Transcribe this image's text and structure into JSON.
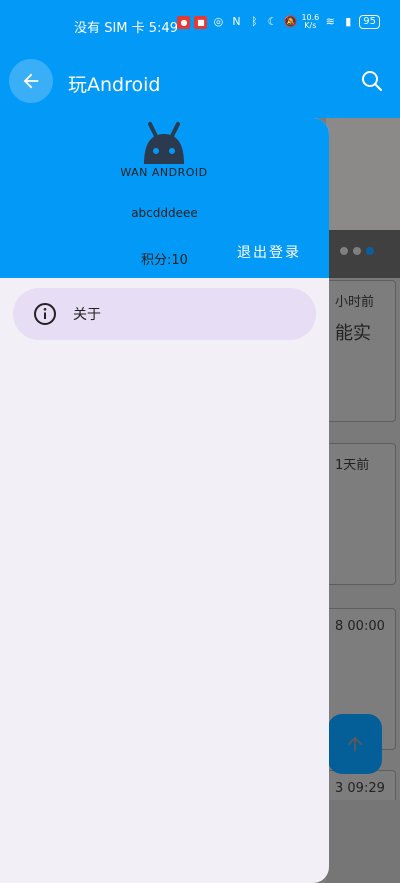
{
  "status_bar": {
    "carrier_time": "没有 SIM 卡 5:49",
    "net_speed_value": "10.6",
    "net_speed_unit": "K/s",
    "battery": "95"
  },
  "app_bar": {
    "title": "玩Android"
  },
  "drawer": {
    "logo_text": "WAN ANDROID",
    "username": "abcdddeee",
    "points": "积分:10",
    "logout_label": "退出登录",
    "menu_items": [
      {
        "label": "关于",
        "icon": "info-icon"
      }
    ]
  },
  "background": {
    "cards": [
      {
        "meta": "小时前",
        "title": "能实"
      },
      {
        "meta": "1天前"
      },
      {
        "meta": "8 00:00"
      },
      {
        "meta": "3 09:29"
      }
    ]
  },
  "colors": {
    "primary": "#0399f7",
    "drawer_bg": "#f3eff6",
    "menu_selected": "#e7ddf4"
  }
}
